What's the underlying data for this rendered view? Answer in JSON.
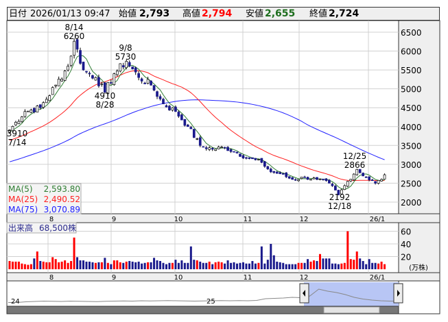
{
  "header": {
    "date_label": "日付",
    "datetime": "2026/01/13 09:47",
    "open_label": "始値",
    "open": "2,793",
    "high_label": "高値",
    "high": "2,794",
    "low_label": "安値",
    "low": "2,655",
    "close_label": "終値",
    "close": "2,724"
  },
  "colors": {
    "up_volume": "#ff0000",
    "down_volume": "#1a1a8c",
    "down_candle": "#1a1a8c",
    "ma5": "#2e7d32",
    "ma25": "#ff2020",
    "ma75": "#2020ff",
    "high_text": "#ff0000",
    "low_text": "#1e6e1e"
  },
  "chart_data": {
    "type": "candlestick",
    "price_axis": {
      "ylim": [
        1600,
        6850
      ],
      "ticks": [
        6500,
        6000,
        5500,
        5000,
        4500,
        4000,
        3500,
        3000,
        2500,
        2000
      ]
    },
    "x_ticks": [
      {
        "label": "8",
        "index": 13
      },
      {
        "label": "9",
        "index": 34
      },
      {
        "label": "10",
        "index": 55
      },
      {
        "label": "11",
        "index": 78
      },
      {
        "label": "12",
        "index": 96
      },
      {
        "label": "26/1",
        "index": 119
      }
    ],
    "price_keypoints": [
      [
        0,
        3910
      ],
      [
        5,
        4400
      ],
      [
        10,
        4500
      ],
      [
        15,
        5100
      ],
      [
        19,
        5600
      ],
      [
        21,
        6260
      ],
      [
        24,
        5500
      ],
      [
        28,
        5300
      ],
      [
        31,
        4910
      ],
      [
        34,
        5400
      ],
      [
        38,
        5730
      ],
      [
        42,
        5300
      ],
      [
        46,
        5100
      ],
      [
        50,
        4600
      ],
      [
        54,
        4400
      ],
      [
        58,
        4000
      ],
      [
        62,
        3500
      ],
      [
        66,
        3400
      ],
      [
        70,
        3450
      ],
      [
        74,
        3300
      ],
      [
        78,
        3150
      ],
      [
        82,
        3050
      ],
      [
        85,
        2800
      ],
      [
        88,
        2750
      ],
      [
        92,
        2600
      ],
      [
        96,
        2650
      ],
      [
        100,
        2600
      ],
      [
        104,
        2500
      ],
      [
        107,
        2192
      ],
      [
        110,
        2550
      ],
      [
        113,
        2866
      ],
      [
        116,
        2650
      ],
      [
        119,
        2500
      ],
      [
        121,
        2600
      ],
      [
        122,
        2724
      ]
    ],
    "history_start_price": 2200,
    "annotations": [
      {
        "date": "8/14",
        "value": "6260"
      },
      {
        "date": "9/8",
        "value": "5730"
      },
      {
        "date": "8/28",
        "value": "4910"
      },
      {
        "date": "7/14",
        "value": "3910"
      },
      {
        "date": "12/25",
        "value": "2866"
      },
      {
        "date": "12/18",
        "value": "2192"
      }
    ],
    "ma_legend": [
      {
        "name": "MA(5)",
        "value": "2,593.80"
      },
      {
        "name": "MA(25)",
        "value": "2,490.52"
      },
      {
        "name": "MA(75)",
        "value": "3,070.89"
      }
    ],
    "volume": {
      "label": "出来高",
      "latest": "68,500株",
      "unit": "(万株)",
      "ticks": [
        60,
        40,
        20
      ],
      "ylim": [
        0,
        65
      ],
      "values": [
        13,
        12,
        12,
        12,
        9,
        8,
        7,
        8,
        17,
        28,
        13,
        12,
        11,
        11,
        19,
        16,
        11,
        12,
        14,
        10,
        13,
        50,
        19,
        14,
        14,
        12,
        12,
        11,
        10,
        11,
        11,
        18,
        10,
        8,
        14,
        14,
        11,
        10,
        12,
        13,
        12,
        11,
        12,
        9,
        10,
        11,
        11,
        18,
        14,
        13,
        10,
        8,
        10,
        10,
        15,
        10,
        14,
        10,
        10,
        36,
        15,
        14,
        12,
        10,
        10,
        12,
        8,
        11,
        12,
        11,
        9,
        14,
        10,
        11,
        9,
        10,
        11,
        9,
        9,
        13,
        9,
        10,
        36,
        9,
        15,
        40,
        22,
        12,
        11,
        10,
        8,
        8,
        8,
        8,
        10,
        10,
        10,
        16,
        12,
        14,
        13,
        24,
        17,
        17,
        17,
        9,
        9,
        8,
        9,
        10,
        60,
        16,
        15,
        28,
        17,
        13,
        8,
        16,
        10,
        10,
        9,
        12,
        8
      ]
    },
    "navigator": {
      "year_labels": [
        "24",
        "25"
      ],
      "prices": [
        2300,
        2300,
        2500,
        2600,
        2700,
        2650,
        2600,
        2700,
        2650,
        2600,
        2550,
        2650,
        2700,
        2750,
        2700,
        2800,
        2750,
        2800,
        2850,
        2800,
        2750,
        2700,
        2750,
        2800,
        2850,
        2800,
        2850,
        2800,
        2900,
        3400,
        3500,
        3600,
        3800,
        3700,
        4200,
        6200,
        5600,
        5200,
        4600,
        3800,
        3300,
        3000,
        2800,
        2700,
        2700
      ]
    }
  }
}
